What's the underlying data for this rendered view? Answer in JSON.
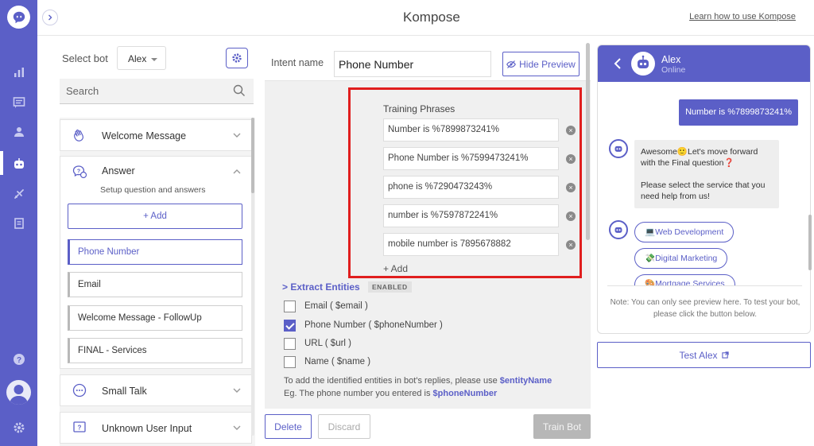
{
  "app": {
    "title": "Kompose",
    "learn_link": "Learn how to use Kompose",
    "accent_color": "#5b5fc7"
  },
  "rail": {
    "icons": [
      "chat-logo-icon",
      "analytics-icon",
      "inbox-icon",
      "users-icon",
      "bot-icon",
      "integrations-icon",
      "reports-icon",
      "help-icon",
      "settings-icon"
    ],
    "active": "bot-icon"
  },
  "bot_selector": {
    "label": "Select bot",
    "value": "Alex"
  },
  "search": {
    "placeholder": "Search"
  },
  "sections": [
    {
      "title": "Welcome Message",
      "expanded": false
    },
    {
      "title": "Answer",
      "expanded": true,
      "subtitle": "Setup question and answers",
      "add_label": "+ Add"
    },
    {
      "title": "Small Talk",
      "expanded": false
    },
    {
      "title": "Unknown User Input",
      "expanded": false
    }
  ],
  "intents": [
    {
      "label": "Phone Number",
      "active": true
    },
    {
      "label": "Email",
      "active": false
    },
    {
      "label": "Welcome Message - FollowUp",
      "active": false
    },
    {
      "label": "FINAL - Services",
      "active": false
    }
  ],
  "editor": {
    "intent_name_label": "Intent name",
    "intent_name_value": "Phone Number",
    "hide_preview_label": "Hide Preview",
    "training_label": "Training Phrases",
    "phrases": [
      "Number is %7899873241%",
      "Phone Number is %7599473241%",
      "phone is %7290473243%",
      "number is %7597872241%",
      "mobile number is 7895678882"
    ],
    "add_label": "+ Add",
    "extract_title": "> Extract Entities",
    "enabled_badge": "ENABLED",
    "entities": [
      {
        "label": "Email ( $email )",
        "checked": false
      },
      {
        "label": "Phone Number ( $phoneNumber )",
        "checked": true
      },
      {
        "label": "URL ( $url )",
        "checked": false
      },
      {
        "label": "Name ( $name )",
        "checked": false
      }
    ],
    "hint_line1_prefix": "To add the identified entities in bot's replies, please use ",
    "hint_line1_token": "$entityName",
    "hint_line2_prefix": "Eg. The phone number you entered is ",
    "hint_line2_token": "$phoneNumber",
    "delete_label": "Delete",
    "discard_label": "Discard",
    "train_label": "Train Bot"
  },
  "preview": {
    "bot_name": "Alex",
    "status": "Online",
    "user_message": "Number is %7899873241%",
    "bot_message_line1": "Awesome🙂Let's move forward with the Final question❓",
    "bot_message_line2": "Please select the service that you need help from us!",
    "options": [
      "💻Web Development",
      "💸Digital Marketing",
      "🎨Mortgage Services"
    ],
    "note": "Note: You can only see preview here. To test your bot, please click the button below.",
    "test_label": "Test Alex"
  }
}
